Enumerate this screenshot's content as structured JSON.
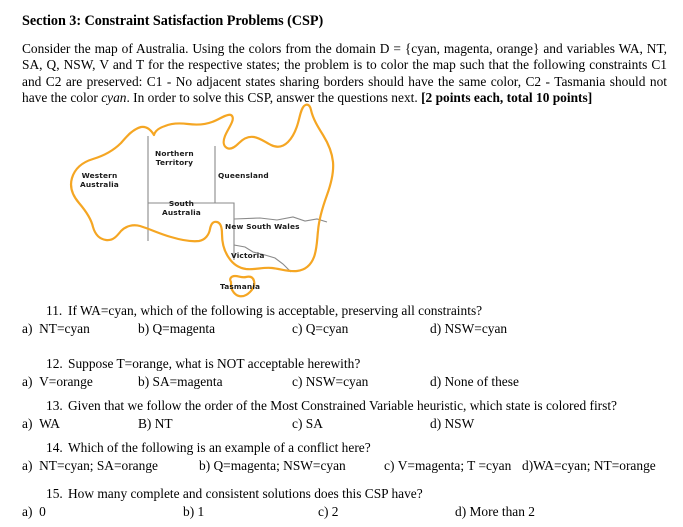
{
  "document": {
    "section_heading": "Section 3: Constraint Satisfaction Problems (CSP)",
    "intro": {
      "part1": "Consider the map of Australia. Using the colors from the domain D = {cyan, magenta, orange} and variables WA, NT, SA, Q, NSW, V and T for the respective states; the problem is to color the map such that the following constraints C1 and C2 are preserved: C1 - No adjacent states sharing borders should have the same color, C2 - Tasmania should not have the color ",
      "italic_word": "cyan",
      "part2": ". In order to solve this CSP, answer the questions next. ",
      "bold_points": "[2 points each, total 10 points]"
    }
  },
  "map": {
    "coast_color": "#F5A623",
    "border_color": "#8a8a8a",
    "labels": {
      "western_australia_line1": "Western",
      "western_australia_line2": "Australia",
      "northern_territory_line1": "Northern",
      "northern_territory_line2": "Territory",
      "queensland": "Queensland",
      "south_australia_line1": "South",
      "south_australia_line2": "Australia",
      "new_south_wales": "New South Wales",
      "victoria": "Victoria",
      "tasmania": "Tasmania"
    }
  },
  "questions": [
    {
      "number": "11.",
      "stem": "If WA=cyan, which of the following is acceptable, preserving all constraints?",
      "options": [
        {
          "label": "a)",
          "text": "NT=cyan"
        },
        {
          "label": "b)",
          "text": "Q=magenta"
        },
        {
          "label": "c)",
          "text": "Q=cyan"
        },
        {
          "label": "d)",
          "text": "NSW=cyan"
        }
      ]
    },
    {
      "number": "12.",
      "stem": "Suppose T=orange, what is NOT acceptable herewith?",
      "options": [
        {
          "label": "a)",
          "text": "V=orange"
        },
        {
          "label": "b)",
          "text": "SA=magenta"
        },
        {
          "label": "c)",
          "text": "NSW=cyan"
        },
        {
          "label": "d)",
          "text": "None of these"
        }
      ]
    },
    {
      "number": "13.",
      "stem": "Given that we follow the order of the Most Constrained Variable heuristic, which state is colored first?",
      "options": [
        {
          "label": "a)",
          "text": "WA"
        },
        {
          "label": "B)",
          "text": "NT"
        },
        {
          "label": "c)",
          "text": "SA"
        },
        {
          "label": "d)",
          "text": "NSW"
        }
      ]
    },
    {
      "number": "14.",
      "stem": "Which of the following is an example of a conflict here?",
      "options": [
        {
          "label": "a)",
          "text": "NT=cyan; SA=orange"
        },
        {
          "label": "b)",
          "text": "Q=magenta; NSW=cyan"
        },
        {
          "label": "c)",
          "text": "V=magenta; T =cyan"
        },
        {
          "label": "d)",
          "text": "WA=cyan; NT=orange"
        }
      ]
    },
    {
      "number": "15.",
      "stem": "How many complete and consistent solutions does this CSP have?",
      "options": [
        {
          "label": "a)",
          "text": "0"
        },
        {
          "label": "b)",
          "text": "1"
        },
        {
          "label": "c)",
          "text": "2"
        },
        {
          "label": "d)",
          "text": "More than 2"
        }
      ]
    }
  ]
}
